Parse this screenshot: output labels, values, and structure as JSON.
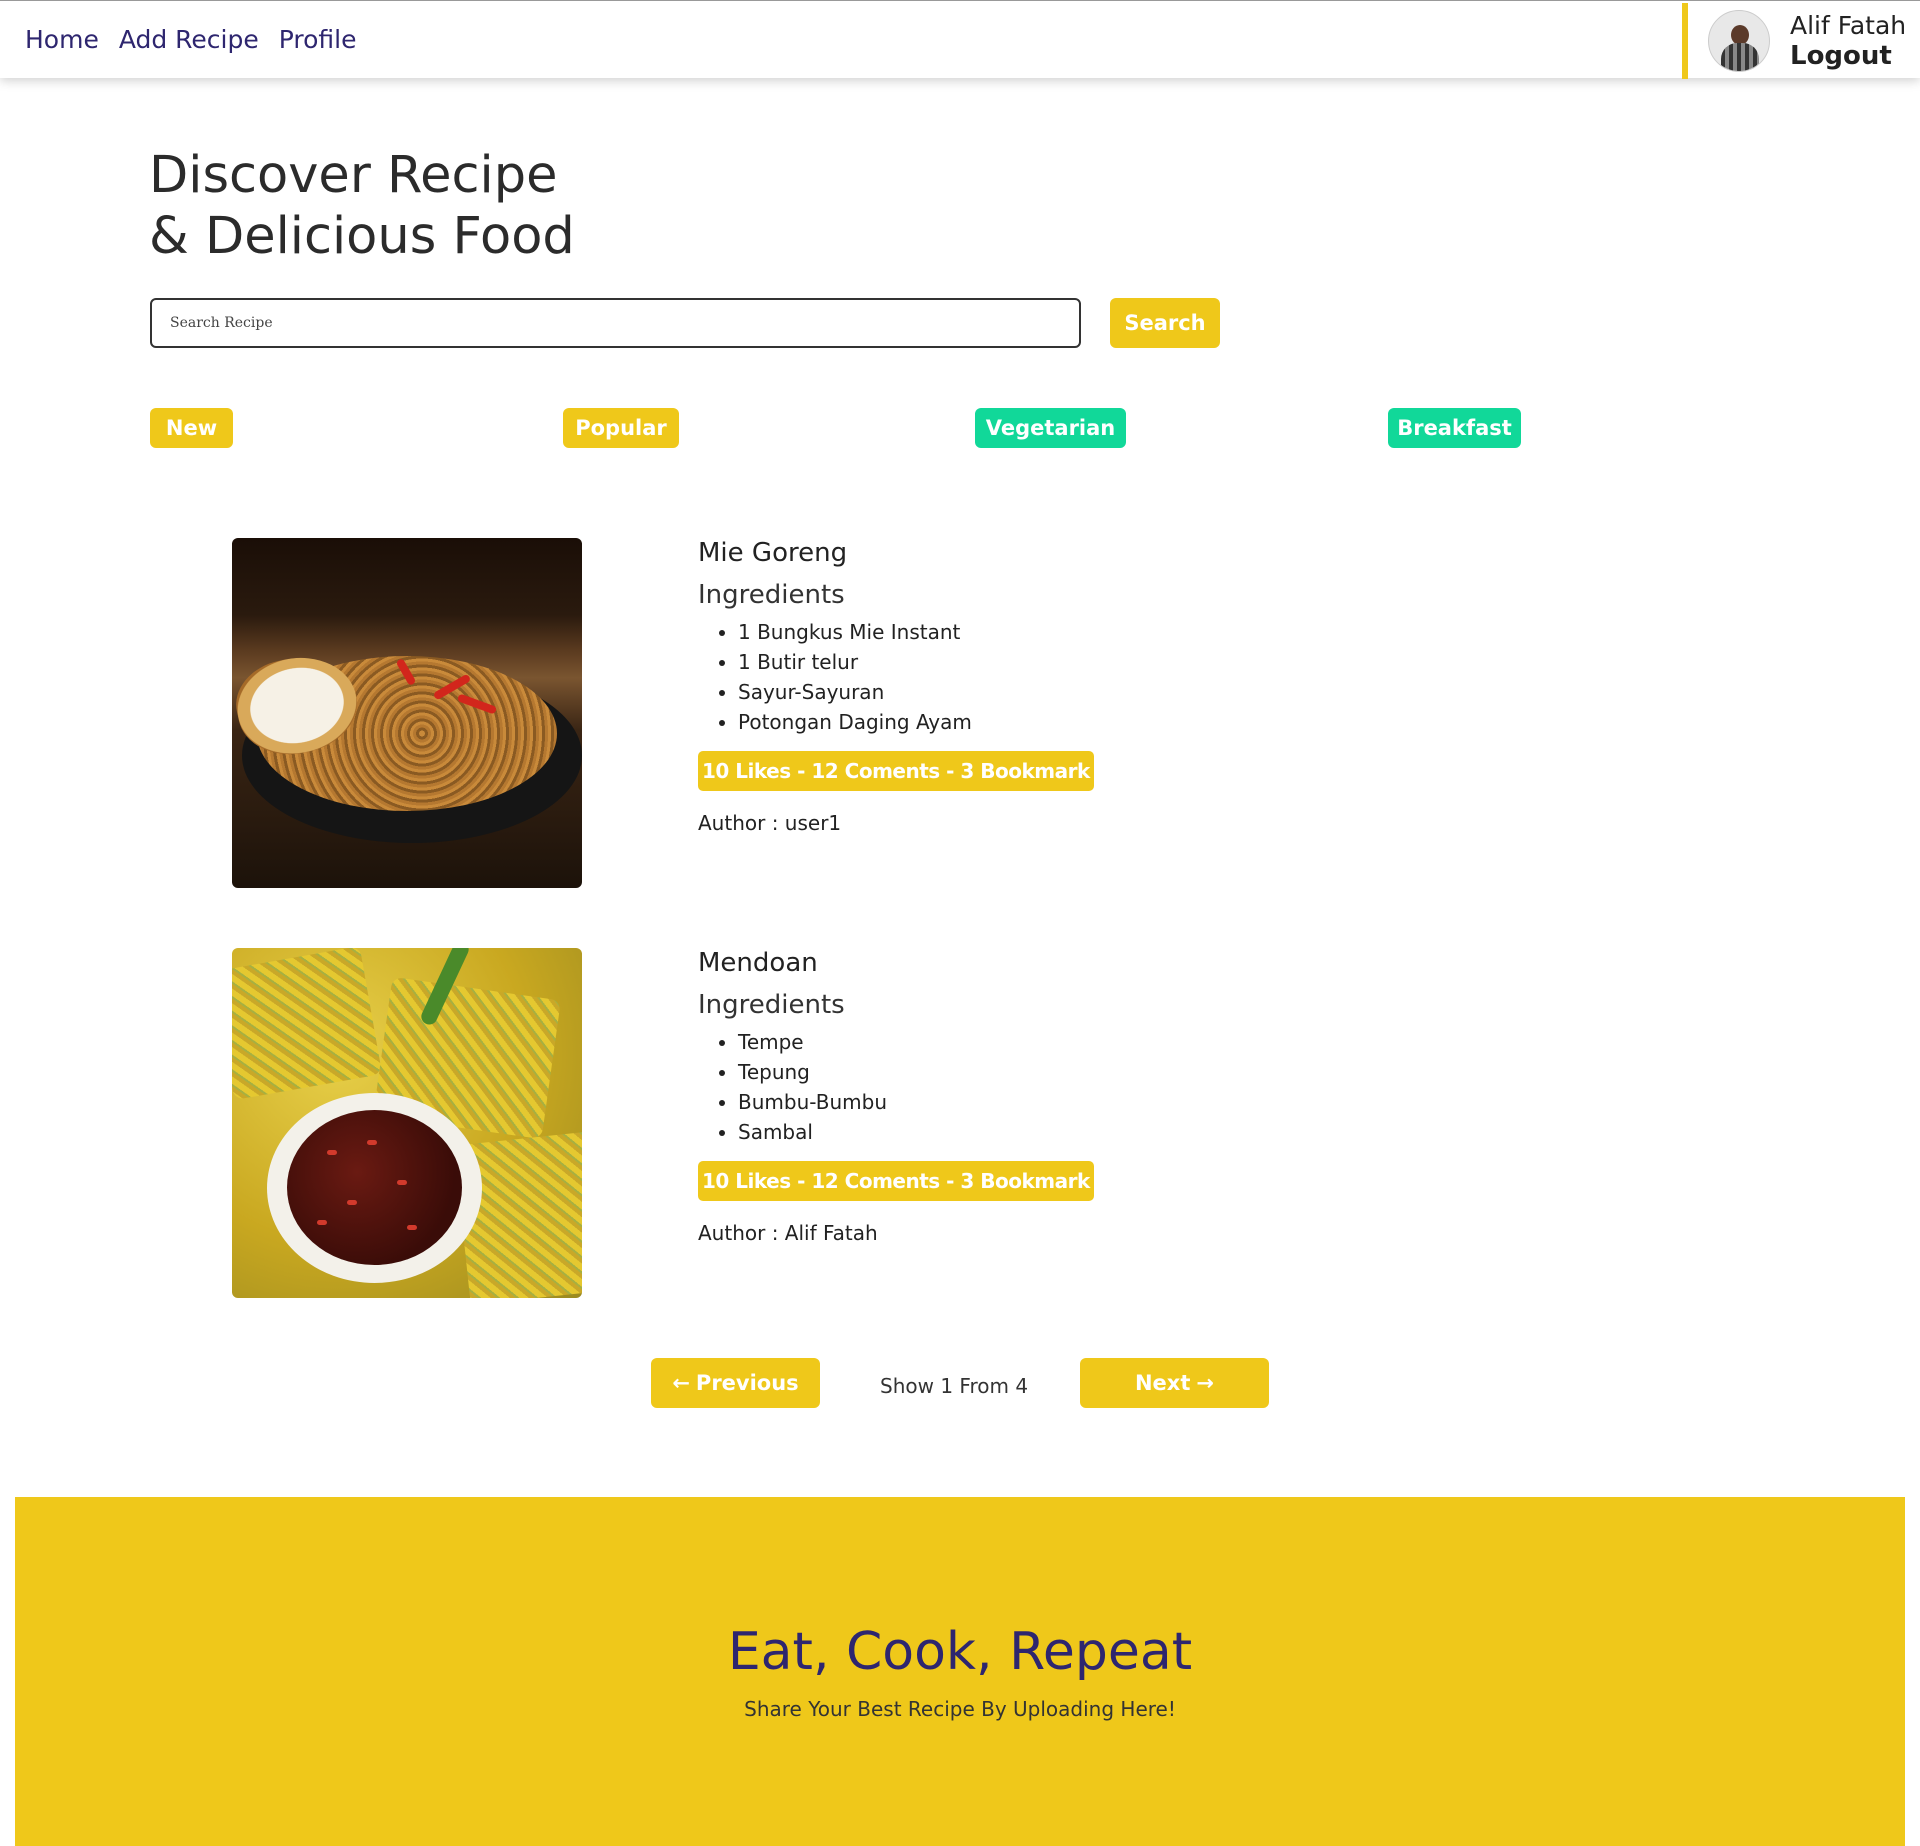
{
  "nav": {
    "links": [
      "Home",
      "Add Recipe",
      "Profile"
    ],
    "user_name": "Alif Fatah",
    "logout_label": "Logout"
  },
  "hero": {
    "title_line1": "Discover Recipe",
    "title_line2": "& Delicious Food"
  },
  "search": {
    "placeholder": "Search Recipe",
    "value": "",
    "button_label": "Search"
  },
  "categories": [
    {
      "label": "New",
      "color": "#efc81a"
    },
    {
      "label": "Popular",
      "color": "#efc81a"
    },
    {
      "label": "Vegetarian",
      "color": "#11d899"
    },
    {
      "label": "Breakfast",
      "color": "#11d899"
    }
  ],
  "ingredients_heading": "Ingredients",
  "author_prefix": "Author :",
  "recipes": [
    {
      "name": "Mie Goreng",
      "ingredients": [
        "1 Bungkus Mie Instant",
        "1 Butir telur",
        "Sayur-Sayuran",
        "Potongan Daging Ayam"
      ],
      "stats": "10 Likes - 12 Coments - 3 Bookmark",
      "author": "user1",
      "image": "fried-noodles-photo"
    },
    {
      "name": "Mendoan",
      "ingredients": [
        "Tempe",
        "Tepung",
        "Bumbu-Bumbu",
        "Sambal"
      ],
      "stats": "10 Likes - 12 Coments - 3 Bookmark",
      "author": "Alif Fatah",
      "image": "fried-tempeh-photo"
    }
  ],
  "pagination": {
    "prev_label": "Previous",
    "next_label": "Next",
    "info": "Show 1 From 4"
  },
  "footer": {
    "title": "Eat, Cook, Repeat",
    "subtitle": "Share Your Best Recipe By Uploading Here!"
  },
  "colors": {
    "accent_yellow": "#efc81a",
    "accent_green": "#11d899",
    "nav_text": "#2e266f"
  }
}
